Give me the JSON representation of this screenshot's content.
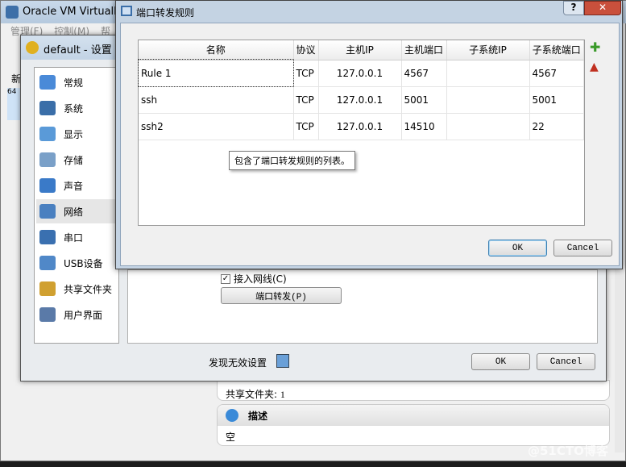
{
  "main_window": {
    "title": "Oracle VM VirtualBo",
    "menu": [
      "管理(F)",
      "控制(M)",
      "帮"
    ],
    "toolbar_new": "新",
    "vm_badge": "64",
    "shared_folders_label": "共享文件夹:",
    "shared_folders_value": "1",
    "description_title": "描述",
    "description_value": "空"
  },
  "settings": {
    "title": "default - 设置",
    "sidebar": [
      {
        "label": "常规",
        "icon": "monitor-icon"
      },
      {
        "label": "系统",
        "icon": "chip-icon"
      },
      {
        "label": "显示",
        "icon": "display-icon"
      },
      {
        "label": "存储",
        "icon": "disk-icon"
      },
      {
        "label": "声音",
        "icon": "speaker-icon"
      },
      {
        "label": "网络",
        "icon": "network-icon",
        "selected": true
      },
      {
        "label": "串口",
        "icon": "serial-icon"
      },
      {
        "label": "USB设备",
        "icon": "usb-icon"
      },
      {
        "label": "共享文件夹",
        "icon": "folder-icon"
      },
      {
        "label": "用户界面",
        "icon": "window-icon"
      }
    ],
    "cable_connected": "接入网线(C)",
    "cable_checked": true,
    "port_forward_button": "端口转发(P)",
    "invalid_settings": "发现无效设置",
    "ok": "OK",
    "cancel": "Cancel"
  },
  "port_forwarding": {
    "title": "端口转发规则",
    "columns": [
      "名称",
      "协议",
      "主机IP",
      "主机端口",
      "子系统IP",
      "子系统端口"
    ],
    "rows": [
      [
        "Rule 1",
        "TCP",
        "127.0.0.1",
        "4567",
        "",
        "4567"
      ],
      [
        "ssh",
        "TCP",
        "127.0.0.1",
        "5001",
        "",
        "5001"
      ],
      [
        "ssh2",
        "TCP",
        "127.0.0.1",
        "14510",
        "",
        "22"
      ]
    ],
    "tooltip": "包含了端口转发规则的列表。",
    "ok": "OK",
    "cancel": "Cancel"
  },
  "watermark": "@51CTO博客",
  "colors": {
    "accent": "#3c7fb1",
    "add_icon": "#3a9a2a",
    "remove_icon": "#c03020"
  }
}
